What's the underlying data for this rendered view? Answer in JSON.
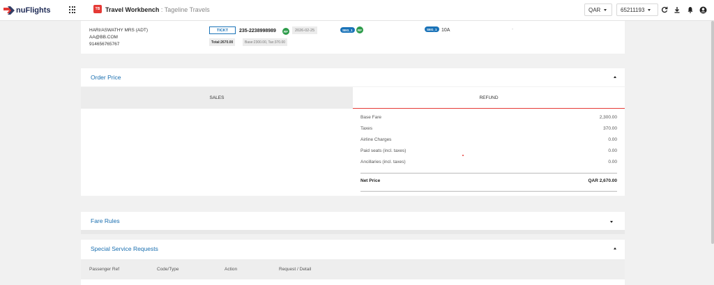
{
  "app": {
    "logo_text": "nuFlights",
    "badge": "TB",
    "title": "Travel Workbench",
    "separator": " : ",
    "subtitle": "Tageline Travels",
    "currency": "QAR",
    "account": "65211193",
    "accent": "#1a6fb0",
    "danger": "#e53935"
  },
  "passenger": {
    "name": "HARI/ASWATHY MRS (ADT)",
    "email": "AA@BB.COM",
    "phone": "914656765767",
    "ticket_button": "TICKT",
    "ticket_number": "235-2238998989",
    "rf": "RF",
    "ticket_date": "2026-02-25",
    "total": "Total:2670.00",
    "base_tax": "Base:2300.00, Tax:370.00",
    "segment_1": "SEG_1",
    "segment_2": "SEG_1",
    "seat": "10A",
    "placeholder_dash": "-"
  },
  "order_price": {
    "title": "Order Price",
    "tabs": {
      "sales": "SALES",
      "refund": "REFUND"
    },
    "rows": [
      {
        "label": "Base Fare",
        "value": "2,300.00"
      },
      {
        "label": "Taxes",
        "value": "370.00"
      },
      {
        "label": "Airline Charges",
        "value": "0.00"
      },
      {
        "label": "Paid seats (incl. taxes)",
        "value": "0.00"
      },
      {
        "label": "Ancillaries (incl. taxes)",
        "value": "0.00"
      }
    ],
    "net_label": "Net Price",
    "net_value": "QAR 2,670.00"
  },
  "fare_rules": {
    "title": "Fare Rules"
  },
  "ssr": {
    "title": "Special Service Requests",
    "columns": [
      "Passenger Ref",
      "Code/Type",
      "Action",
      "Request / Detail"
    ]
  }
}
